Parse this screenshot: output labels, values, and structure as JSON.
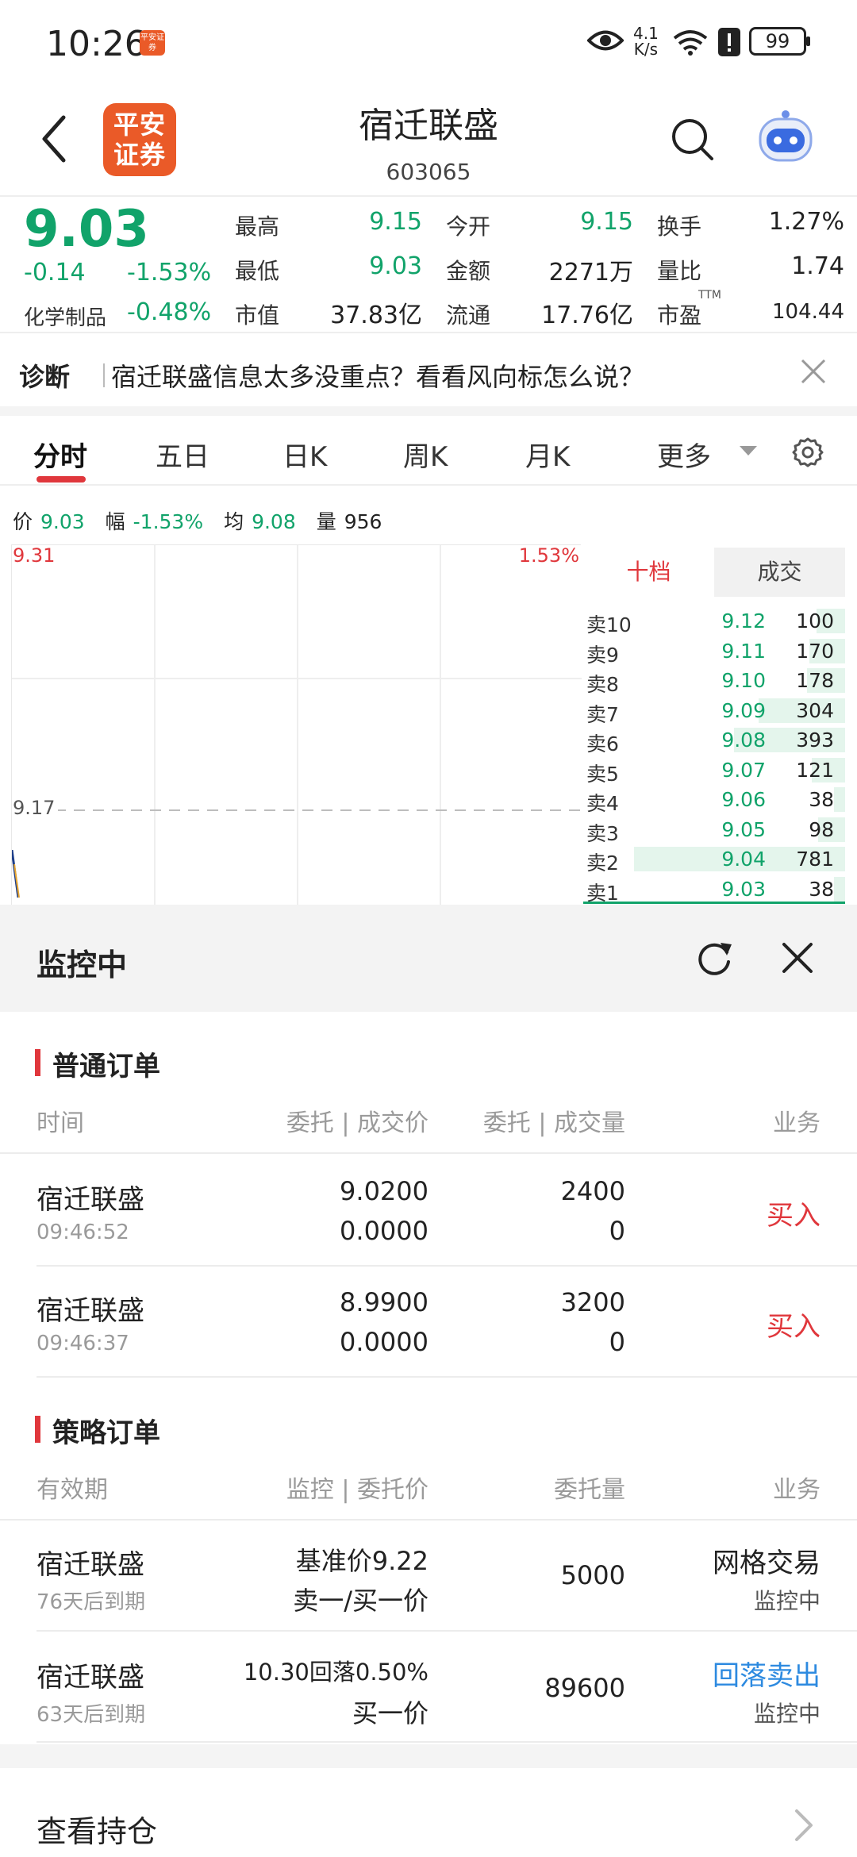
{
  "status_bar": {
    "time": "10:26",
    "app_badge": "平安证券",
    "net_speed_top": "4.1",
    "net_speed_bottom": "K/s",
    "battery": "99"
  },
  "header": {
    "logo_text": "平安证券",
    "title": "宿迁联盛",
    "code": "603065"
  },
  "quote": {
    "price": "9.03",
    "change": "-0.14",
    "change_pct": "-1.53%",
    "industry": "化学制品",
    "industry_pct": "-0.48%",
    "fields": [
      {
        "label": "最高",
        "value": "9.15"
      },
      {
        "label": "最低",
        "value": "9.03"
      },
      {
        "label": "市值",
        "value": "37.83亿"
      },
      {
        "label": "今开",
        "value": "9.15"
      },
      {
        "label": "金额",
        "value": "2271万"
      },
      {
        "label": "流通",
        "value": "17.76亿"
      },
      {
        "label": "换手",
        "value": "1.27%"
      },
      {
        "label": "量比",
        "value": "1.74"
      },
      {
        "label": "市盈",
        "value": "104.44",
        "superscript": "TTM"
      }
    ]
  },
  "diagnosis": {
    "label": "诊断",
    "text": "宿迁联盛信息太多没重点？看看风向标怎么说？"
  },
  "tabs": [
    "分时",
    "五日",
    "日K",
    "周K",
    "月K",
    "更多"
  ],
  "info_line": {
    "price_label": "价",
    "price": "9.03",
    "range_label": "幅",
    "range": "-1.53%",
    "avg_label": "均",
    "avg": "9.08",
    "vol_label": "量",
    "vol": "956"
  },
  "chart": {
    "top_price": "9.31",
    "top_pct": "1.53%",
    "mid_price": "9.17"
  },
  "order_book": {
    "tab_active": "十档",
    "tab_other": "成交",
    "rows": [
      {
        "level": "卖10",
        "price": "9.12",
        "volume": "100",
        "bar": 0.13
      },
      {
        "level": "卖9",
        "price": "9.11",
        "volume": "170",
        "bar": 0.16
      },
      {
        "level": "卖8",
        "price": "9.10",
        "volume": "178",
        "bar": 0.17
      },
      {
        "level": "卖7",
        "price": "9.09",
        "volume": "304",
        "bar": 0.39
      },
      {
        "level": "卖6",
        "price": "9.08",
        "volume": "393",
        "bar": 0.5
      },
      {
        "level": "卖5",
        "price": "9.07",
        "volume": "121",
        "bar": 0.15
      },
      {
        "level": "卖4",
        "price": "9.06",
        "volume": "38",
        "bar": 0.05
      },
      {
        "level": "卖3",
        "price": "9.05",
        "volume": "98",
        "bar": 0.12
      },
      {
        "level": "卖2",
        "price": "9.04",
        "volume": "781",
        "bar": 0.95
      },
      {
        "level": "卖1",
        "price": "9.03",
        "volume": "38",
        "bar": 0.05
      }
    ]
  },
  "monitor": {
    "title": "监控中",
    "normal": {
      "title": "普通订单",
      "headers": [
        "时间",
        "委托 | 成交价",
        "委托 | 成交量",
        "业务"
      ],
      "rows": [
        {
          "name": "宿迁联盛",
          "time": "09:46:52",
          "order_price": "9.0200",
          "deal_price": "0.0000",
          "order_qty": "2400",
          "deal_qty": "0",
          "biz": "买入"
        },
        {
          "name": "宿迁联盛",
          "time": "09:46:37",
          "order_price": "8.9900",
          "deal_price": "0.0000",
          "order_qty": "3200",
          "deal_qty": "0",
          "biz": "买入"
        }
      ]
    },
    "strategy": {
      "title": "策略订单",
      "headers": [
        "有效期",
        "监控 | 委托价",
        "委托量",
        "业务"
      ],
      "rows": [
        {
          "name": "宿迁联盛",
          "expiry": "76天后到期",
          "monitor": "基准价9.22",
          "order_price": "卖一/买一价",
          "qty": "5000",
          "biz": "网格交易",
          "status": "监控中"
        },
        {
          "name": "宿迁联盛",
          "expiry": "63天后到期",
          "monitor": "10.30回落0.50%",
          "order_price": "买一价",
          "qty": "89600",
          "biz": "回落卖出",
          "status": "监控中"
        }
      ]
    },
    "holdings": "查看持仓"
  },
  "colors": {
    "down_green": "#11a36a",
    "up_red": "#e0373c",
    "brand_orange": "#ea5a28",
    "link_blue": "#2d8ae0"
  }
}
